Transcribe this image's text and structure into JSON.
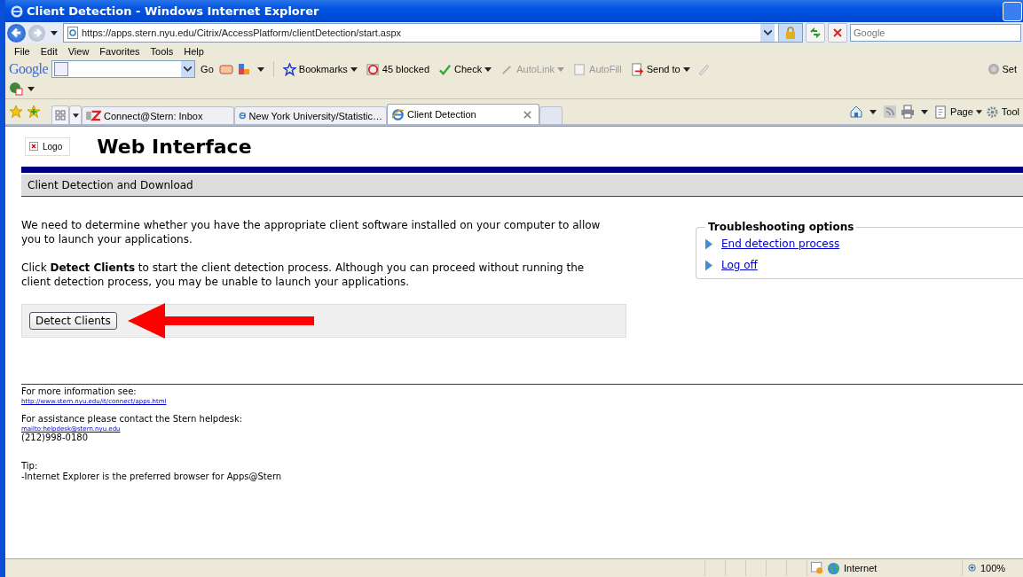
{
  "window": {
    "title": "Client Detection - Windows Internet Explorer"
  },
  "address_bar": {
    "url": "https://apps.stern.nyu.edu/Citrix/AccessPlatform/clientDetection/start.aspx"
  },
  "search": {
    "placeholder": "Google"
  },
  "menu": [
    "File",
    "Edit",
    "View",
    "Favorites",
    "Tools",
    "Help"
  ],
  "google_toolbar": {
    "brand": "Google",
    "go": "Go",
    "items": [
      {
        "kind": "star",
        "label": "Bookmarks",
        "disabled": false,
        "dropdown": true
      },
      {
        "kind": "block",
        "label": "45 blocked",
        "disabled": false,
        "dropdown": false
      },
      {
        "kind": "check",
        "label": "Check",
        "disabled": false,
        "dropdown": true
      },
      {
        "kind": "link",
        "label": "AutoLink",
        "disabled": true,
        "dropdown": true
      },
      {
        "kind": "fill",
        "label": "AutoFill",
        "disabled": true,
        "dropdown": false
      },
      {
        "kind": "send",
        "label": "Send to",
        "disabled": false,
        "dropdown": true
      }
    ],
    "settings": "Set"
  },
  "tabs": [
    {
      "label": "Connect@Stern: Inbox",
      "selected": false,
      "kind": "ez"
    },
    {
      "label": "New York University/Statistic…",
      "selected": false,
      "kind": "ie"
    },
    {
      "label": "Client Detection",
      "selected": true,
      "kind": "ie"
    }
  ],
  "command_bar": [
    "Page",
    "Tool"
  ],
  "page": {
    "logo_alt": "Logo",
    "heading": "Web Interface",
    "section_title": "Client Detection and Download",
    "paragraphs": [
      "We need to determine whether you have the appropriate client software installed on your computer to allow you to launch your applications.",
      "Click **Detect Clients** to start the client detection process. Although you can proceed without running the client detection process, you may be unable to launch your applications."
    ],
    "button": "Detect Clients",
    "troubleshooting": {
      "title": "Troubleshooting options",
      "links": [
        "End detection process",
        "Log off"
      ]
    },
    "footer": [
      {
        "kind": "text",
        "text": "For more information see:"
      },
      {
        "kind": "link",
        "text": "http://www.stern.nyu.edu/it/connect/apps.html"
      },
      {
        "kind": "gap"
      },
      {
        "kind": "text",
        "text": "For assistance please contact the Stern helpdesk:"
      },
      {
        "kind": "link",
        "text": "mailto:helpdesk@stern.nyu.edu"
      },
      {
        "kind": "text",
        "text": "(212)998-0180"
      },
      {
        "kind": "gap"
      },
      {
        "kind": "gap"
      },
      {
        "kind": "text",
        "text": "Tip:"
      },
      {
        "kind": "text",
        "text": "-Internet Explorer is the preferred browser for Apps@Stern"
      }
    ]
  },
  "status_bar": {
    "zone": "Internet",
    "zoom": "100%"
  }
}
